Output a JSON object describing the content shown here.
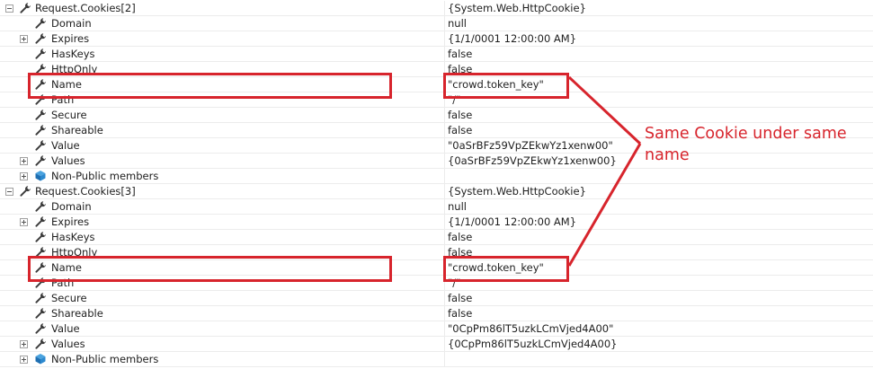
{
  "groups": [
    {
      "root": {
        "name": "Request.Cookies[2]",
        "value": "{System.Web.HttpCookie}"
      },
      "children": [
        {
          "name": "Domain",
          "value": "null",
          "expander": false,
          "icon": "wrench-icon"
        },
        {
          "name": "Expires",
          "value": "{1/1/0001 12:00:00 AM}",
          "expander": true,
          "icon": "wrench-icon"
        },
        {
          "name": "HasKeys",
          "value": "false",
          "expander": false,
          "icon": "wrench-icon"
        },
        {
          "name": "HttpOnly",
          "value": "false",
          "expander": false,
          "icon": "wrench-icon"
        },
        {
          "name": "Name",
          "value": "\"crowd.token_key\"",
          "expander": false,
          "icon": "wrench-icon",
          "highlighted": true
        },
        {
          "name": "Path",
          "value": "\"/\"",
          "expander": false,
          "icon": "wrench-icon"
        },
        {
          "name": "Secure",
          "value": "false",
          "expander": false,
          "icon": "wrench-icon"
        },
        {
          "name": "Shareable",
          "value": "false",
          "expander": false,
          "icon": "wrench-icon"
        },
        {
          "name": "Value",
          "value": "\"0aSrBFz59VpZEkwYz1xenw00\"",
          "expander": false,
          "icon": "wrench-icon"
        },
        {
          "name": "Values",
          "value": "{0aSrBFz59VpZEkwYz1xenw00}",
          "expander": true,
          "icon": "wrench-icon"
        },
        {
          "name": "Non-Public members",
          "value": "",
          "expander": true,
          "icon": "members-icon"
        }
      ]
    },
    {
      "root": {
        "name": "Request.Cookies[3]",
        "value": "{System.Web.HttpCookie}"
      },
      "children": [
        {
          "name": "Domain",
          "value": "null",
          "expander": false,
          "icon": "wrench-icon"
        },
        {
          "name": "Expires",
          "value": "{1/1/0001 12:00:00 AM}",
          "expander": true,
          "icon": "wrench-icon"
        },
        {
          "name": "HasKeys",
          "value": "false",
          "expander": false,
          "icon": "wrench-icon"
        },
        {
          "name": "HttpOnly",
          "value": "false",
          "expander": false,
          "icon": "wrench-icon"
        },
        {
          "name": "Name",
          "value": "\"crowd.token_key\"",
          "expander": false,
          "icon": "wrench-icon",
          "highlighted": true
        },
        {
          "name": "Path",
          "value": "\"/\"",
          "expander": false,
          "icon": "wrench-icon"
        },
        {
          "name": "Secure",
          "value": "false",
          "expander": false,
          "icon": "wrench-icon"
        },
        {
          "name": "Shareable",
          "value": "false",
          "expander": false,
          "icon": "wrench-icon"
        },
        {
          "name": "Value",
          "value": "\"0CpPm86lT5uzkLCmVjed4A00\"",
          "expander": false,
          "icon": "wrench-icon"
        },
        {
          "name": "Values",
          "value": "{0CpPm86lT5uzkLCmVjed4A00}",
          "expander": true,
          "icon": "wrench-icon"
        },
        {
          "name": "Non-Public members",
          "value": "",
          "expander": true,
          "icon": "members-icon"
        }
      ]
    }
  ],
  "annotation": {
    "text": "Same Cookie under same name"
  },
  "colors": {
    "highlight": "#d7242c",
    "gridline": "#ececec",
    "text": "#1e1e1e"
  }
}
